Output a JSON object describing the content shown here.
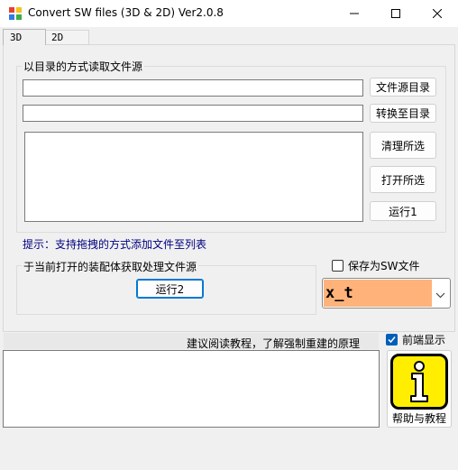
{
  "window": {
    "title": "Convert SW files (3D & 2D) Ver2.0.8"
  },
  "tabs": [
    {
      "label": "3D",
      "selected": true
    },
    {
      "label": "2D",
      "selected": false
    }
  ],
  "dir_group": {
    "label": "以目录的方式读取文件源",
    "source_dir_value": "",
    "target_dir_value": "",
    "source_dir_button": "文件源目录",
    "target_dir_button": "转换至目录",
    "clear_button": "清理所选",
    "open_button": "打开所选",
    "run1_button": "运行1"
  },
  "hint_text": "提示：支持拖拽的方式添加文件至列表",
  "assembly_group": {
    "label": "于当前打开的装配体获取处理文件源",
    "run2_button": "运行2"
  },
  "save_as_sw": {
    "label": "保存为SW文件",
    "checked": false
  },
  "format_combo": {
    "value": "x_t"
  },
  "tutorial_hint": "建议阅读教程，了解强制重建的原理",
  "front_display": {
    "label": "前端显示",
    "checked": true
  },
  "help_button": {
    "label": "帮助与教程"
  },
  "log_value": "",
  "colors": {
    "accent": "#005fb8",
    "combo_highlight": "#ffb37a",
    "hint_text": "#000080",
    "help_icon_bg": "#ffee00"
  }
}
